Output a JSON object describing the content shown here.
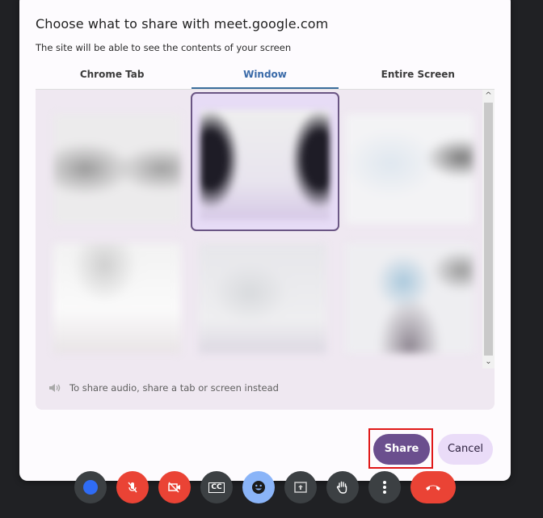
{
  "dialog": {
    "title": "Choose what to share with meet.google.com",
    "subtitle": "The site will be able to see the contents of your screen",
    "tabs": [
      {
        "label": "Chrome Tab",
        "active": false
      },
      {
        "label": "Window",
        "active": true
      },
      {
        "label": "Entire Screen",
        "active": false
      }
    ],
    "windows": [
      {
        "id": "window-1",
        "selected": false
      },
      {
        "id": "window-2",
        "selected": true
      },
      {
        "id": "window-3",
        "selected": false
      },
      {
        "id": "window-4",
        "selected": false
      },
      {
        "id": "window-5",
        "selected": false
      },
      {
        "id": "window-6",
        "selected": false
      }
    ],
    "scroll": {
      "up_icon": "chevron-up-icon",
      "down_icon": "chevron-down-icon"
    },
    "audio_note": "To share audio, share a tab or screen instead",
    "buttons": {
      "share": "Share",
      "cancel": "Cancel"
    },
    "colors": {
      "accent": "#6b4f8e",
      "tab_active": "#3a6aa8",
      "highlight": "#e01818"
    }
  },
  "meet_controls": [
    {
      "name": "self-view-tile",
      "icon": "dot-icon"
    },
    {
      "name": "microphone-off",
      "icon": "mic-off-icon"
    },
    {
      "name": "camera-off",
      "icon": "camera-off-icon"
    },
    {
      "name": "captions",
      "icon": "captions-icon",
      "label": "CC"
    },
    {
      "name": "reactions",
      "icon": "emoji-icon"
    },
    {
      "name": "present",
      "icon": "present-icon"
    },
    {
      "name": "raise-hand",
      "icon": "hand-icon"
    },
    {
      "name": "more-options",
      "icon": "more-vert-icon"
    },
    {
      "name": "leave-call",
      "icon": "end-call-icon"
    }
  ]
}
